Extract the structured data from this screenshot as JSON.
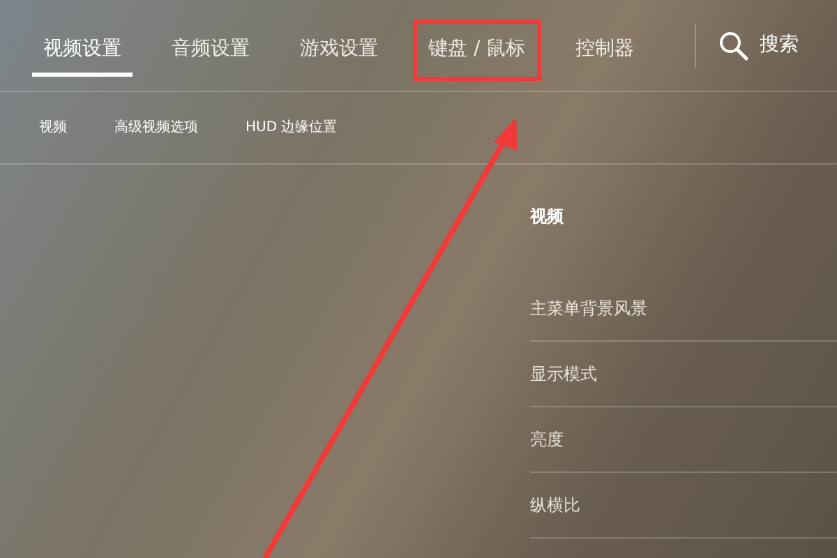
{
  "tabs": [
    {
      "label": "视频设置",
      "selected": true,
      "highlighted": false
    },
    {
      "label": "音频设置",
      "selected": false,
      "highlighted": false
    },
    {
      "label": "游戏设置",
      "selected": false,
      "highlighted": false
    },
    {
      "label": "键盘 / 鼠标",
      "selected": false,
      "highlighted": true
    },
    {
      "label": "控制器",
      "selected": false,
      "highlighted": false
    }
  ],
  "search": {
    "label": "搜索"
  },
  "subtabs": [
    "视频",
    "高级视频选项",
    "HUD 边缘位置"
  ],
  "section": {
    "title": "视频",
    "items": [
      "主菜单背景风景",
      "显示模式",
      "亮度",
      "纵横比"
    ]
  }
}
